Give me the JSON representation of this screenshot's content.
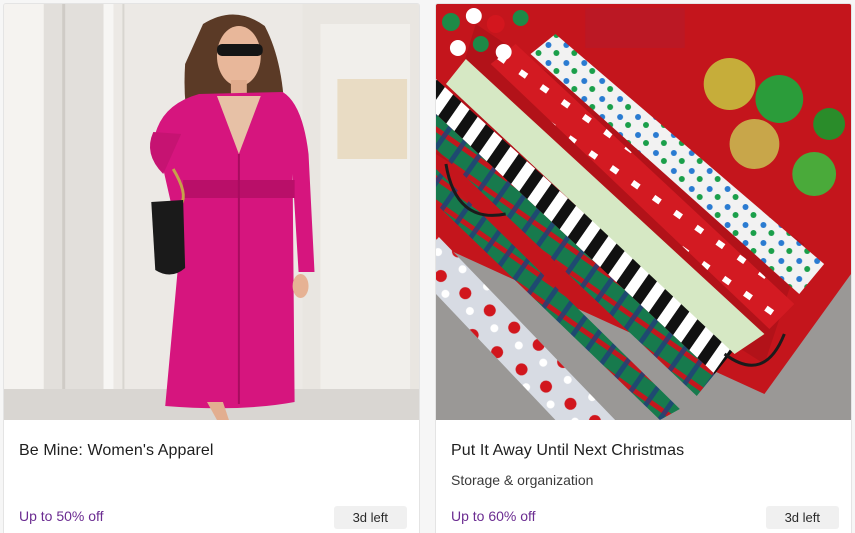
{
  "cards": [
    {
      "image_alt": "Woman in a pink trench coat holding a black handbag",
      "title": "Be Mine: Women's Apparel",
      "subtitle": "",
      "discount": "Up to 50% off",
      "time_left": "3d left",
      "colors": {
        "coat": "#d6157e",
        "background": "#ece9e5"
      }
    },
    {
      "image_alt": "Gift wrap rolls stored in a red organizer with bows",
      "title": "Put It Away Until Next Christmas",
      "subtitle": "Storage & organization",
      "discount": "Up to 60% off",
      "time_left": "3d left",
      "colors": {
        "organizer": "#c4151c",
        "background": "#9a9896"
      }
    }
  ],
  "theme": {
    "discount_color": "#6b2c91",
    "badge_bg": "#f0f0f0"
  }
}
